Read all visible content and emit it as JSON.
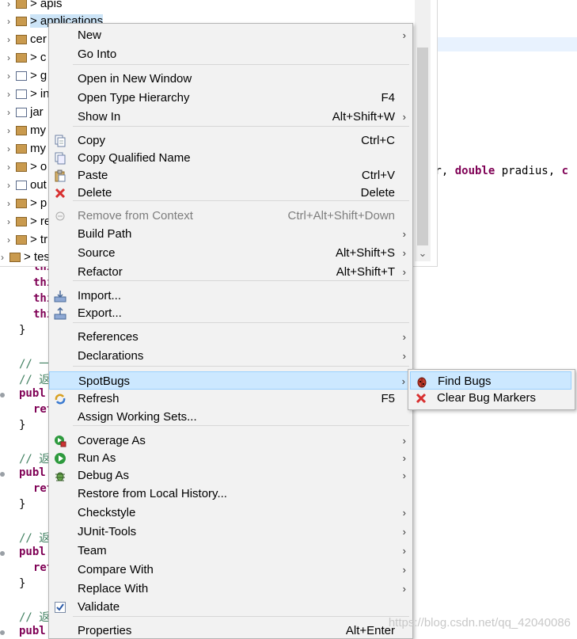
{
  "explorer": {
    "items": [
      {
        "label": "> apis",
        "icon": "package-folder-icon"
      },
      {
        "label": "> applications",
        "icon": "package-folder-icon",
        "selected": true
      },
      {
        "label": "cer",
        "icon": "package-folder-icon"
      },
      {
        "label": "> c",
        "icon": "package-folder-icon"
      },
      {
        "label": "> g",
        "icon": "grid-folder-icon"
      },
      {
        "label": "> in",
        "icon": "grid-folder-icon"
      },
      {
        "label": "jar",
        "icon": "grid-folder-icon"
      },
      {
        "label": "my",
        "icon": "package-folder-icon"
      },
      {
        "label": "my",
        "icon": "package-folder-icon"
      },
      {
        "label": "> o",
        "icon": "package-folder-icon"
      },
      {
        "label": "out",
        "icon": "grid-folder-icon"
      },
      {
        "label": "> p",
        "icon": "package-folder-icon"
      },
      {
        "label": "> re",
        "icon": "package-folder-icon"
      },
      {
        "label": "> tr",
        "icon": "package-folder-icon"
      },
      {
        "label": "> test",
        "icon": "package-folder-icon"
      }
    ]
  },
  "editor": {
    "signature": {
      "pre": "or, ",
      "kw": "double",
      "mid": " pradius, ",
      "tail": "c"
    },
    "lines_this": [
      "thi",
      "thi",
      "thi",
      "thi"
    ],
    "brace": "}",
    "comments": [
      "// 一",
      "// 返",
      "// 返",
      "// 返",
      "// 返"
    ],
    "publ": "publ",
    "ret": "ret"
  },
  "menu": {
    "items": [
      {
        "label": "New",
        "shortcut": "",
        "submenu": true,
        "icon": ""
      },
      {
        "label": "Go Into",
        "shortcut": "",
        "submenu": false,
        "icon": ""
      },
      {
        "sep": true
      },
      {
        "label": "Open in New Window",
        "shortcut": "",
        "submenu": false,
        "icon": ""
      },
      {
        "label": "Open Type Hierarchy",
        "shortcut": "F4",
        "submenu": false,
        "icon": ""
      },
      {
        "label": "Show In",
        "shortcut": "Alt+Shift+W",
        "submenu": true,
        "icon": ""
      },
      {
        "sep": true
      },
      {
        "label": "Copy",
        "shortcut": "Ctrl+C",
        "submenu": false,
        "icon": "copy-icon"
      },
      {
        "label": "Copy Qualified Name",
        "shortcut": "",
        "submenu": false,
        "icon": "copy-qualified-icon"
      },
      {
        "label": "Paste",
        "shortcut": "Ctrl+V",
        "submenu": false,
        "icon": "paste-icon"
      },
      {
        "label": "Delete",
        "shortcut": "Delete",
        "submenu": false,
        "icon": "delete-icon"
      },
      {
        "sep": true
      },
      {
        "label": "Remove from Context",
        "shortcut": "Ctrl+Alt+Shift+Down",
        "submenu": false,
        "icon": "remove-context-icon",
        "disabled": true
      },
      {
        "label": "Build Path",
        "shortcut": "",
        "submenu": true,
        "icon": ""
      },
      {
        "label": "Source",
        "shortcut": "Alt+Shift+S",
        "submenu": true,
        "icon": ""
      },
      {
        "label": "Refactor",
        "shortcut": "Alt+Shift+T",
        "submenu": true,
        "icon": ""
      },
      {
        "sep": true
      },
      {
        "label": "Import...",
        "shortcut": "",
        "submenu": false,
        "icon": "import-icon"
      },
      {
        "label": "Export...",
        "shortcut": "",
        "submenu": false,
        "icon": "export-icon"
      },
      {
        "sep": true
      },
      {
        "label": "References",
        "shortcut": "",
        "submenu": true,
        "icon": ""
      },
      {
        "label": "Declarations",
        "shortcut": "",
        "submenu": true,
        "icon": ""
      },
      {
        "sep": true
      },
      {
        "label": "SpotBugs",
        "shortcut": "",
        "submenu": true,
        "icon": "",
        "hover": true
      },
      {
        "label": "Refresh",
        "shortcut": "F5",
        "submenu": false,
        "icon": "refresh-icon"
      },
      {
        "label": "Assign Working Sets...",
        "shortcut": "",
        "submenu": false,
        "icon": ""
      },
      {
        "sep": true
      },
      {
        "label": "Coverage As",
        "shortcut": "",
        "submenu": true,
        "icon": "coverage-icon"
      },
      {
        "label": "Run As",
        "shortcut": "",
        "submenu": true,
        "icon": "run-icon"
      },
      {
        "label": "Debug As",
        "shortcut": "",
        "submenu": true,
        "icon": "debug-icon"
      },
      {
        "label": "Restore from Local History...",
        "shortcut": "",
        "submenu": false,
        "icon": ""
      },
      {
        "label": "Checkstyle",
        "shortcut": "",
        "submenu": true,
        "icon": ""
      },
      {
        "label": "JUnit-Tools",
        "shortcut": "",
        "submenu": true,
        "icon": ""
      },
      {
        "label": "Team",
        "shortcut": "",
        "submenu": true,
        "icon": ""
      },
      {
        "label": "Compare With",
        "shortcut": "",
        "submenu": true,
        "icon": ""
      },
      {
        "label": "Replace With",
        "shortcut": "",
        "submenu": true,
        "icon": ""
      },
      {
        "label": "Validate",
        "shortcut": "",
        "submenu": false,
        "icon": "validate-check-icon"
      },
      {
        "sep": true
      },
      {
        "label": "Properties",
        "shortcut": "Alt+Enter",
        "submenu": false,
        "icon": ""
      }
    ]
  },
  "submenu": {
    "items": [
      {
        "label": "Find Bugs",
        "icon": "find-bugs-icon",
        "hover": true
      },
      {
        "label": "Clear Bug Markers",
        "icon": "clear-markers-icon"
      }
    ]
  },
  "watermark": "https://blog.csdn.net/qq_42040086",
  "colors": {
    "menu_bg": "#f2f2f2",
    "hover": "#cce8ff",
    "selection": "#cce4f7",
    "keyword": "#7f0055",
    "comment": "#3f7f5f"
  }
}
